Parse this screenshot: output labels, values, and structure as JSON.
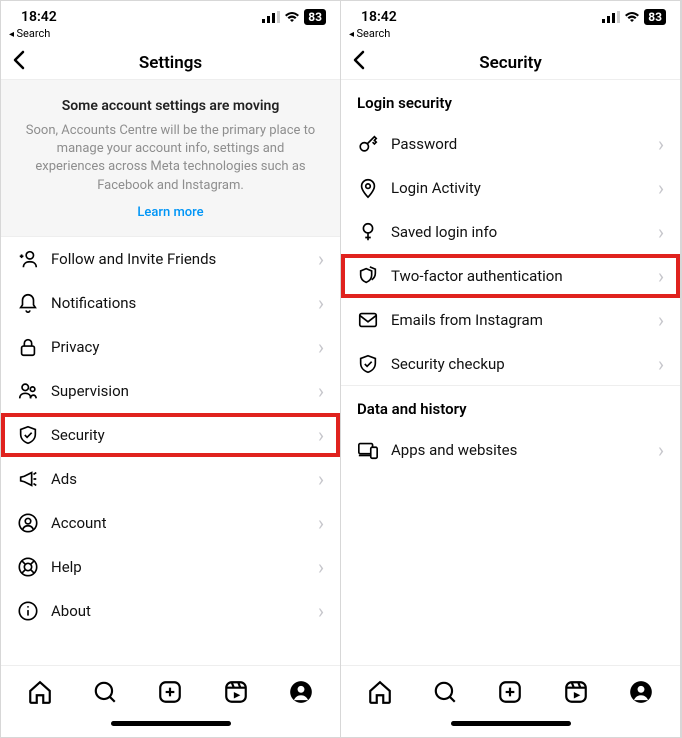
{
  "statusbar": {
    "time": "18:42",
    "battery": "83"
  },
  "backsearch": "Search",
  "screens": {
    "settings": {
      "title": "Settings",
      "banner": {
        "heading": "Some account settings are moving",
        "body": "Soon, Accounts Centre will be the primary place to manage your account info, settings and experiences across Meta technologies such as Facebook and Instagram.",
        "link": "Learn more"
      },
      "items": [
        {
          "label": "Follow and Invite Friends"
        },
        {
          "label": "Notifications"
        },
        {
          "label": "Privacy"
        },
        {
          "label": "Supervision"
        },
        {
          "label": "Security",
          "highlight": true
        },
        {
          "label": "Ads"
        },
        {
          "label": "Account"
        },
        {
          "label": "Help"
        },
        {
          "label": "About"
        }
      ]
    },
    "security": {
      "title": "Security",
      "sections": {
        "login": {
          "label": "Login security",
          "items": [
            {
              "label": "Password"
            },
            {
              "label": "Login Activity"
            },
            {
              "label": "Saved login info"
            },
            {
              "label": "Two-factor authentication",
              "highlight": true
            },
            {
              "label": "Emails from Instagram"
            },
            {
              "label": "Security checkup"
            }
          ]
        },
        "datahistory": {
          "label": "Data and history",
          "items": [
            {
              "label": "Apps and websites"
            }
          ]
        }
      }
    }
  }
}
